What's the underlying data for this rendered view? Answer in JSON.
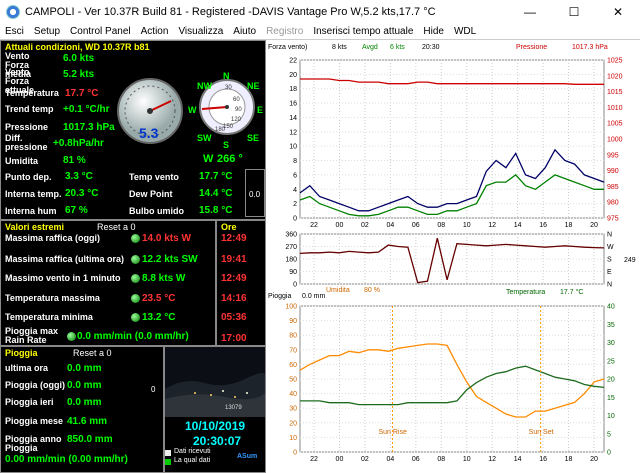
{
  "window": {
    "title": "CAMPOLI - Ver 10.37R Build 81 - Registered  -DAVIS Vantage Pro   W,5.2 kts,17.7 °C",
    "minimize": "—",
    "maximize": "☐",
    "close": "✕"
  },
  "menu": [
    "Esci",
    "Setup",
    "Control Panel",
    "Action",
    "Visualizza",
    "Aiuto",
    "Registro",
    "Inserisci tempo attuale",
    "Hide",
    "WDL"
  ],
  "current": {
    "header": "Attuali condizioni, WD 10.37R b81",
    "vento_media_label": "Vento Forza media",
    "vento_media_value": "6.0 kts",
    "vento_attuale_label": "Vento Forza attuale",
    "vento_attuale_value": "5.2 kts",
    "temperatura_label": "Temperatura",
    "temperatura_value": "17.7 °C",
    "trend_label": "Trend temp",
    "trend_value": "+0.1 °C/hr",
    "pressione_label": "Pressione",
    "pressione_value": "1017.3 hPa",
    "diff_label": "Diff. pressione",
    "diff_value": "+0.8hPa/hr",
    "umidita_label": "Umidita",
    "umidita_value": "81 %",
    "wind_dir": "W",
    "wind_deg": "266 °",
    "punto_label": "Punto dep.",
    "punto_value": "3.3 °C",
    "interna_temp_label": "Interna temp.",
    "interna_temp_value": "20.3 °C",
    "interna_hum_label": "Interna hum",
    "interna_hum_value": "67 %",
    "temp_vento_label": "Temp vento",
    "temp_vento_value": "17.7 °C",
    "dew_label": "Dew Point",
    "dew_value": "14.4 °C",
    "bulbo_label": "Bulbo umido",
    "bulbo_value": "15.8 °C",
    "side_value": "0.0",
    "gauge_value": "5.3",
    "compass": {
      "n": "N",
      "ne": "NE",
      "e": "E",
      "se": "SE",
      "s": "S",
      "sw": "SW",
      "w": "W",
      "nw": "NW",
      "t30": "30",
      "t60": "60",
      "t90": "90",
      "t120": "120",
      "t150": "150",
      "t180": "180"
    }
  },
  "extremes": {
    "header": "Valori estremi",
    "reset": "Reset a 0",
    "rows": [
      {
        "label": "Massima raffica (oggi)",
        "value": "14.0 kts W",
        "color": "#ff3333"
      },
      {
        "label": "Massima raffica (ultima ora)",
        "value": "12.2 kts  SW",
        "color": "#00ff00"
      },
      {
        "label": "Massimo vento in 1 minuto",
        "value": "8.8 kts W",
        "color": "#00ff00"
      },
      {
        "label": "Temperatura massima",
        "value": "23.5 °C",
        "color": "#ff3333"
      },
      {
        "label": "Temperatura minima",
        "value": "13.2 °C",
        "color": "#00ff00"
      },
      {
        "label": "Pioggia max Rain Rate",
        "value": "0.0 mm/min (0.0 mm/hr)",
        "color": "#00ff00"
      }
    ],
    "ore_header": "Ore",
    "ore": [
      "12:49",
      "19:41",
      "12:49",
      "14:16",
      "05:36",
      "17:00"
    ]
  },
  "rain": {
    "header": "Pioggia",
    "reset": "Reset a 0",
    "rows": [
      {
        "label": "ultima ora",
        "value": "0.0 mm"
      },
      {
        "label": "Pioggia (oggi)",
        "value": "0.0 mm"
      },
      {
        "label": "Pioggia ieri",
        "value": "0.0 mm"
      },
      {
        "label": "Pioggia mese",
        "value": "41.6 mm"
      },
      {
        "label": "Pioggia anno",
        "value": "850.0 mm"
      }
    ],
    "rate_label": "Pioggia",
    "rate_value": "0.00 mm/min (0.00 mm/hr)"
  },
  "camera": {
    "date": "10/10/2019",
    "time": "20:30:07",
    "counter": "13079",
    "side": "0",
    "legend1": "Dati ricevuti",
    "legend2": "La qual dati",
    "logo": "ASum"
  },
  "chart_data": [
    {
      "type": "line",
      "title": "",
      "labels": {
        "left": "Forza vento)",
        "kts": "8 kts",
        "avg": "Avgd",
        "kts2": "6 kts",
        "time": "20:30",
        "right": "Pressione",
        "press_value": "1017.3 hPa"
      },
      "x": [
        "22",
        "00",
        "02",
        "04",
        "06",
        "08",
        "10",
        "12",
        "14",
        "16",
        "18",
        "20"
      ],
      "ylim": [
        0,
        22
      ],
      "y2lim": [
        975,
        1025
      ],
      "y_ticks": [
        "22",
        "20",
        "18",
        "16",
        "14",
        "12",
        "10",
        "8",
        "6",
        "4",
        "2",
        "0"
      ],
      "y2_ticks": [
        "1025",
        "1020",
        "1015",
        "1010",
        "1005",
        "1000",
        "995",
        "990",
        "985",
        "980",
        "975"
      ],
      "series": [
        {
          "name": "Forza vento",
          "color": "#000066",
          "values": [
            3.5,
            4.5,
            3.0,
            2.5,
            2.0,
            1.5,
            1.0,
            1.0,
            1.5,
            2.0,
            2.5,
            3.0,
            2.0,
            1.5,
            1.5,
            2.0,
            2.0,
            2.5,
            3.0,
            6.5,
            8.0,
            7.0,
            9.0,
            6.0,
            5.5,
            7.0,
            9.5,
            8.0,
            7.5,
            6.0,
            5.5,
            5.0
          ]
        },
        {
          "name": "Avgd",
          "color": "#008000",
          "values": [
            2.5,
            3.0,
            2.0,
            1.5,
            1.0,
            0.5,
            0.3,
            0.3,
            0.5,
            1.0,
            1.5,
            1.5,
            1.0,
            0.5,
            0.5,
            1.0,
            1.0,
            1.5,
            2.0,
            4.5,
            5.0,
            5.0,
            6.0,
            4.5,
            4.0,
            5.0,
            6.0,
            5.5,
            5.0,
            4.5,
            4.0,
            4.0
          ]
        },
        {
          "name": "Pressione",
          "axis": "right",
          "color": "#cc0000",
          "values": [
            1019,
            1019,
            1019,
            1019,
            1018.5,
            1018.5,
            1018,
            1018,
            1018,
            1017.5,
            1017.5,
            1017.5,
            1018,
            1018,
            1017.5,
            1017.5,
            1017.5,
            1017.5,
            1017.5,
            1017.5,
            1017.5,
            1017.5,
            1017.5,
            1017.5,
            1017.5,
            1017.5,
            1017.5,
            1017.5,
            1017.3,
            1017.3,
            1017.3,
            1017.3
          ]
        }
      ]
    },
    {
      "type": "line",
      "title": "",
      "x": [
        "22",
        "00",
        "02",
        "04",
        "06",
        "08",
        "10",
        "12",
        "14",
        "16",
        "18",
        "20"
      ],
      "ylim": [
        0,
        360
      ],
      "y_ticks": [
        "360",
        "270",
        "180",
        "90",
        "0"
      ],
      "right_ticks": [
        "N",
        "W",
        "S",
        "E",
        "N"
      ],
      "right_value": "249",
      "series": [
        {
          "name": "Direzione",
          "color": "#660000",
          "values": [
            220,
            225,
            225,
            230,
            225,
            235,
            230,
            225,
            230,
            280,
            270,
            265,
            10,
            20,
            330,
            30,
            290,
            285,
            280,
            275,
            280,
            285,
            280,
            275,
            270,
            265,
            270,
            275,
            270,
            265,
            262,
            260
          ]
        }
      ]
    },
    {
      "type": "line",
      "title": "",
      "labels": {
        "pioggia": "Pioggia",
        "pioggia_value": "0.0 mm",
        "umidita": "Umidita",
        "umidita_value": "80 %",
        "temperatura": "Temperatura",
        "temperatura_value": "17.7 °C",
        "sunrise": "Sun Rise",
        "sunset": "Sun Set"
      },
      "x": [
        "22",
        "00",
        "02",
        "04",
        "06",
        "08",
        "10",
        "12",
        "14",
        "16",
        "18",
        "20"
      ],
      "ylim": [
        0,
        100
      ],
      "y2lim": [
        0,
        40
      ],
      "y_ticks": [
        "100",
        "90",
        "80",
        "70",
        "60",
        "50",
        "40",
        "30",
        "20",
        "10",
        "0"
      ],
      "y2_ticks": [
        "40",
        "35",
        "30",
        "25",
        "20",
        "15",
        "10",
        "5",
        "0"
      ],
      "sunrise_x": 7.3,
      "sunset_x": 19.0,
      "series": [
        {
          "name": "Umidita",
          "color": "#ff8c00",
          "values": [
            56,
            60,
            63,
            66,
            66,
            69,
            68,
            70,
            70,
            69,
            71,
            72,
            73,
            74,
            74,
            73,
            60,
            48,
            38,
            34,
            30,
            26,
            24,
            24,
            28,
            28,
            30,
            32,
            34,
            40,
            48,
            50
          ]
        },
        {
          "name": "Temperatura",
          "axis": "right",
          "color": "#1e6b1e",
          "values": [
            14,
            14,
            14,
            13.5,
            13.5,
            13.5,
            13,
            13,
            13,
            13,
            13,
            13.5,
            13.5,
            13.5,
            13.5,
            13.5,
            14,
            17,
            19,
            20.5,
            21.5,
            22,
            23,
            23.5,
            22.5,
            21.5,
            20.5,
            20,
            19.5,
            18.5,
            18,
            17.7
          ]
        }
      ]
    }
  ]
}
